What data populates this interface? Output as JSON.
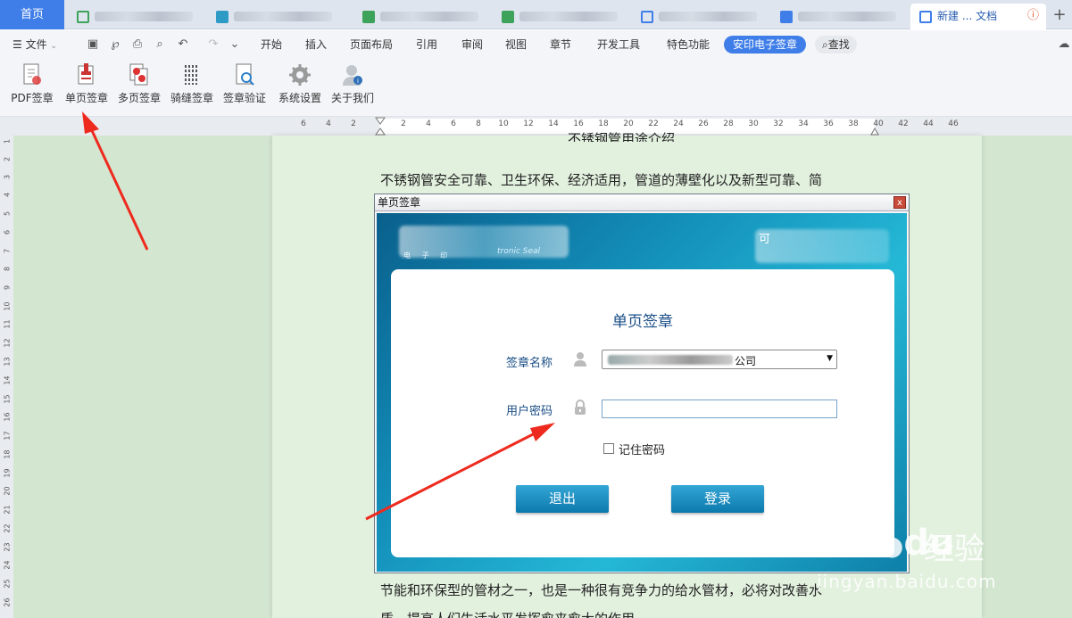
{
  "tabs": {
    "home": "首页",
    "active": {
      "label": "新建 ... 文档",
      "close": "ⓘ"
    },
    "colors": [
      "#3da35b",
      "#2e9bc7",
      "#3da35b",
      "#3da35b",
      "#3f7ee8",
      "#3f7ee8"
    ]
  },
  "menu": {
    "file": "文件",
    "items": [
      "开始",
      "插入",
      "页面布局",
      "引用",
      "审阅",
      "视图",
      "章节",
      "开发工具",
      "特色功能"
    ],
    "active": "安印电子签章",
    "search": "查找"
  },
  "ribbon": {
    "buttons": [
      {
        "label": "PDF签章",
        "icon": "pdf-seal-icon"
      },
      {
        "label": "单页签章",
        "icon": "single-page-seal-icon"
      },
      {
        "label": "多页签章",
        "icon": "multi-page-seal-icon"
      },
      {
        "label": "骑缝签章",
        "icon": "cross-page-seal-icon"
      },
      {
        "label": "签章验证",
        "icon": "verify-seal-icon"
      },
      {
        "label": "系统设置",
        "icon": "gear-icon"
      },
      {
        "label": "关于我们",
        "icon": "about-user-icon"
      }
    ]
  },
  "ruler": {
    "left": [
      "6",
      "4",
      "2"
    ],
    "main": [
      "2",
      "4",
      "6",
      "8",
      "10",
      "12",
      "14",
      "16",
      "18",
      "20",
      "22",
      "24",
      "26",
      "28",
      "30",
      "32",
      "34",
      "36",
      "38",
      "40",
      "42",
      "44",
      "46"
    ],
    "vertical": [
      "1",
      "2",
      "3",
      "4",
      "5",
      "6",
      "7",
      "8",
      "9",
      "10",
      "11",
      "12",
      "13",
      "14",
      "15",
      "16",
      "17",
      "18",
      "19",
      "20",
      "21",
      "22",
      "23",
      "24",
      "25",
      "26"
    ]
  },
  "document": {
    "heading": "不锈钢管用途介绍",
    "line1": "不锈钢管安全可靠、卫生环保、经济适用，管道的薄壁化以及新型可靠、简",
    "line2": "节能和环保型的管材之一，也是一种很有竞争力的给水管材，必将对改善水",
    "line3": "质、提高人们生活水平发挥愈来愈大的作用。"
  },
  "dialog": {
    "title": "单页签章",
    "close": "x",
    "banner": {
      "logo_caption": "电 子 印",
      "logo_sub": "tronic Seal",
      "right_caption": "可"
    },
    "card_title": "单页签章",
    "seal_name_label": "签章名称",
    "seal_name_value": "公司",
    "password_label": "用户密码",
    "password_value": "",
    "remember_label": "记住密码",
    "remember_checked": false,
    "exit_label": "退出",
    "login_label": "登录"
  },
  "watermark": {
    "brand": "Bai",
    "brand2": "du",
    "product": "经验",
    "url": "jingyan.baidu.com"
  }
}
